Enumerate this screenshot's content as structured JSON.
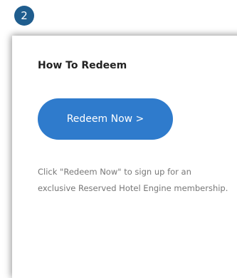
{
  "step": {
    "number": "2"
  },
  "card": {
    "title": "How To Redeem",
    "button_label": "Redeem Now >",
    "description": "Click \"Redeem Now\" to sign up for an exclusive Reserved Hotel Engine membership."
  },
  "colors": {
    "badge": "#1f5d8e",
    "button": "#2f7bcc",
    "title_text": "#222222",
    "body_text": "#777777"
  }
}
